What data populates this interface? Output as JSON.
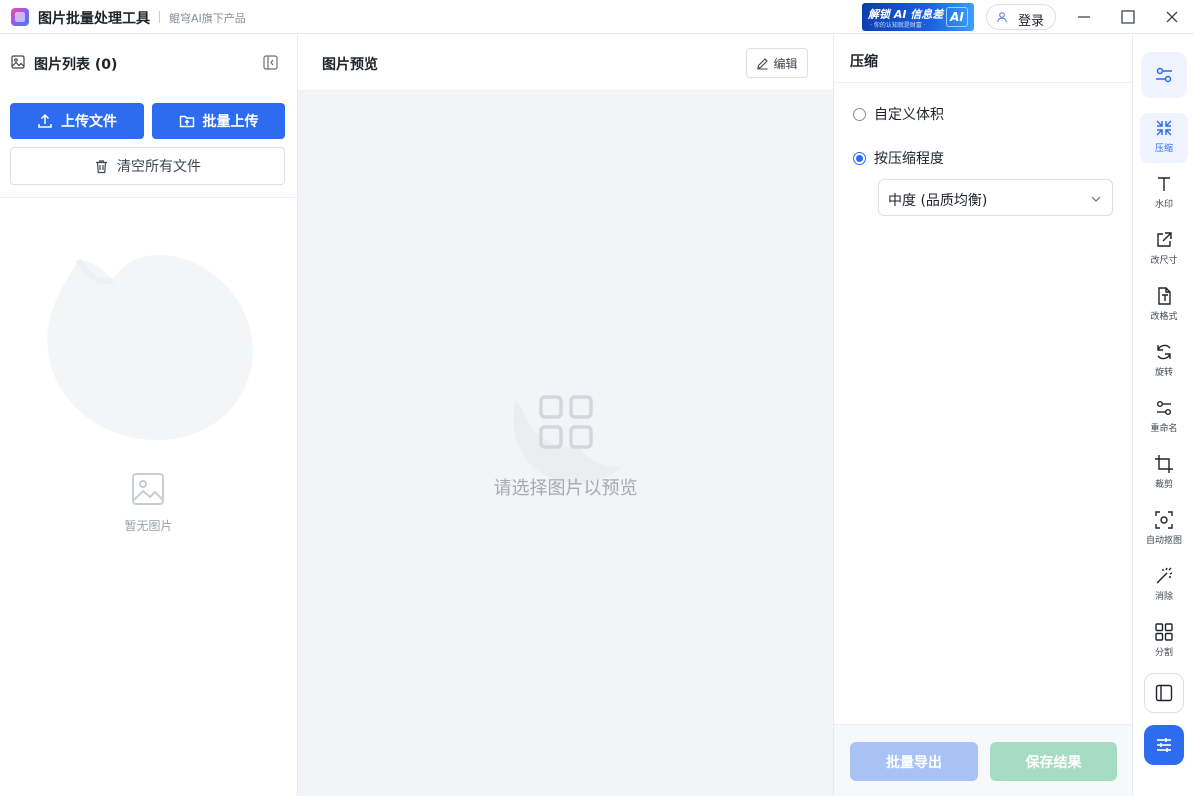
{
  "titlebar": {
    "app_title": "图片批量处理工具",
    "subtitle": "鲲穹AI旗下产品",
    "promo_text": "解锁 AI 信息差",
    "promo_sub": "· 你的认知就是财富 ·",
    "promo_badge": "AI",
    "login_label": "登录"
  },
  "left_panel": {
    "title": "图片列表 (0)",
    "upload_label": "上传文件",
    "batch_upload_label": "批量上传",
    "clear_label": "清空所有文件",
    "empty_text": "暂无图片"
  },
  "preview": {
    "title": "图片预览",
    "edit_label": "编辑",
    "placeholder": "请选择图片以预览"
  },
  "settings": {
    "title": "压缩",
    "option_custom": "自定义体积",
    "option_level": "按压缩程度",
    "selected_option": "按压缩程度",
    "level_value": "中度 (品质均衡)",
    "export_label": "批量导出",
    "save_label": "保存结果"
  },
  "tools": [
    {
      "label": "压缩",
      "icon": "compress-icon",
      "active": true
    },
    {
      "label": "水印",
      "icon": "text-icon",
      "active": false
    },
    {
      "label": "改尺寸",
      "icon": "resize-icon",
      "active": false
    },
    {
      "label": "改格式",
      "icon": "format-icon",
      "active": false
    },
    {
      "label": "旋转",
      "icon": "rotate-icon",
      "active": false
    },
    {
      "label": "重命名",
      "icon": "rename-icon",
      "active": false
    },
    {
      "label": "裁剪",
      "icon": "crop-icon",
      "active": false
    },
    {
      "label": "自动抠图",
      "icon": "cutout-icon",
      "active": false
    },
    {
      "label": "消除",
      "icon": "magic-wand-icon",
      "active": false
    },
    {
      "label": "分割",
      "icon": "grid-icon",
      "active": false
    }
  ],
  "colors": {
    "primary": "#2d6bf0",
    "export_disabled": "#a9c2f5",
    "save_disabled": "#a6dcc3",
    "preview_bg": "#f3f4f7"
  }
}
